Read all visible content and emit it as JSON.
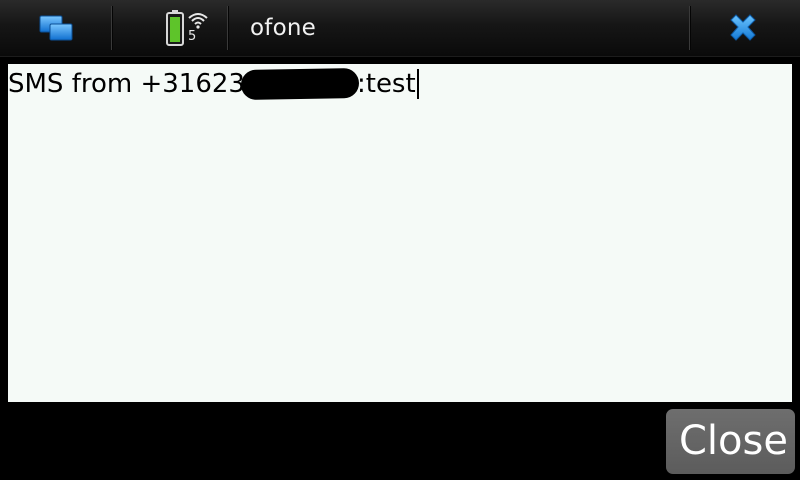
{
  "titlebar": {
    "switcher_icon": "task-switcher-icon",
    "battery_icon": "battery-icon",
    "signal_icon": "wifi-signal-icon",
    "signal_count": "5",
    "app_title": "ofone",
    "close_icon": "close-icon"
  },
  "message": {
    "prefix": "SMS from +31623",
    "redacted": true,
    "suffix": ":test"
  },
  "buttons": {
    "close_label": "Close"
  },
  "colors": {
    "background": "#000000",
    "message_bg": "#f5faf7",
    "button_bg": "#666666",
    "accent_blue": "#1a8fe0",
    "battery_green": "#5ec42a"
  }
}
